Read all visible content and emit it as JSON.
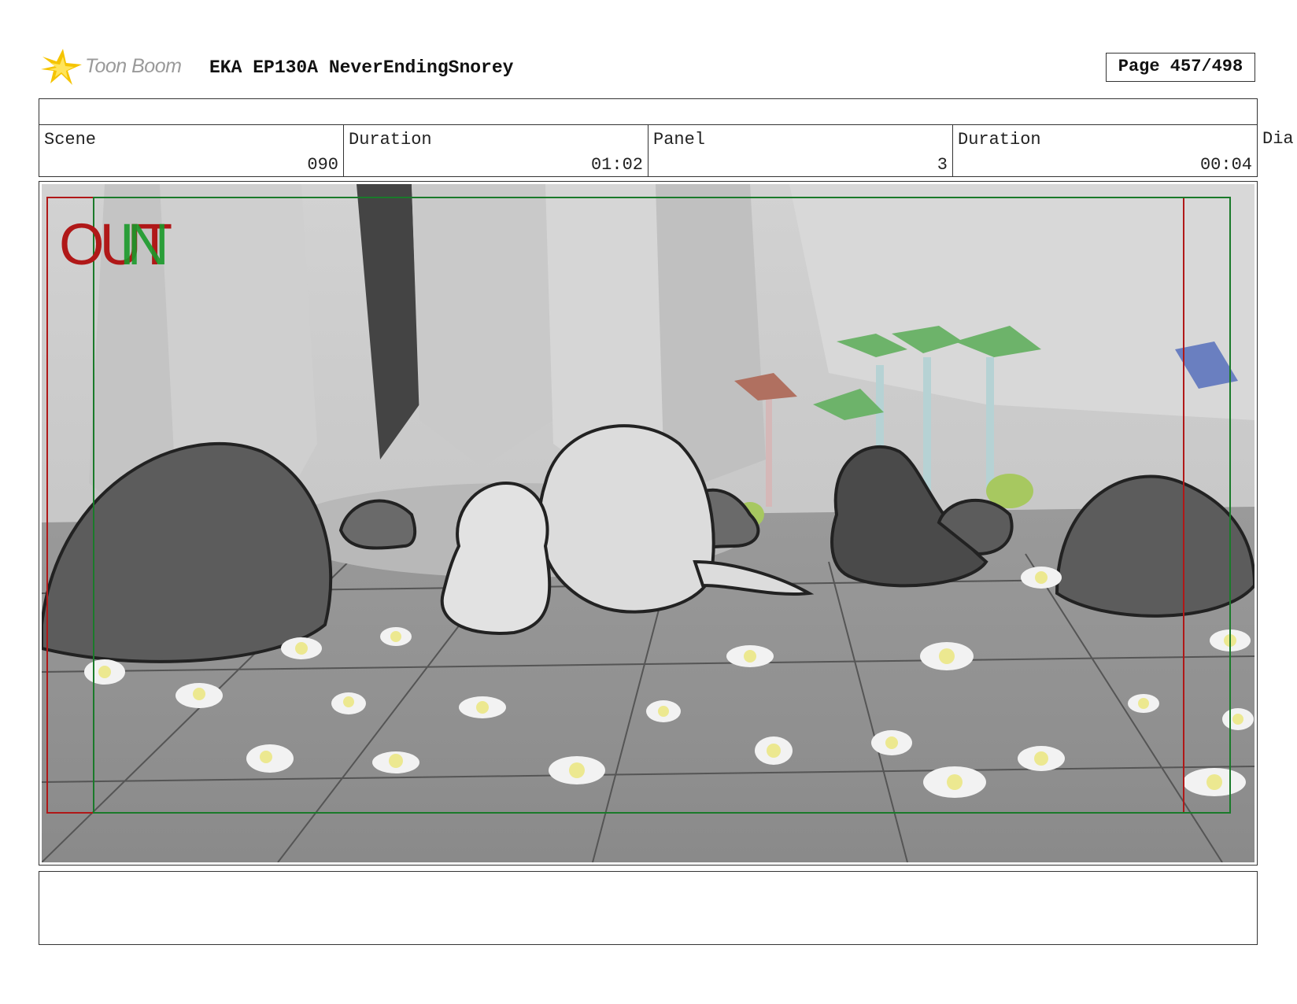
{
  "header": {
    "logo_text": "Toon Boom",
    "title": "EKA EP130A NeverEndingSnorey",
    "page_label": "Page 457/498"
  },
  "info": {
    "scene_label": "Scene",
    "scene_value": "090",
    "duration_label": "Duration",
    "duration_value": "01:02",
    "panel_label": "Panel",
    "panel_value": "3",
    "panel_duration_label": "Duration",
    "panel_duration_value": "00:04",
    "dialog_label_partial": "Dia"
  },
  "panel_overlay": {
    "out_text": "OUT",
    "in_text": "IN"
  },
  "colors": {
    "safe_frame_red": "#b01818",
    "safe_frame_green": "#1a7a2a",
    "logo_yellow": "#f5c400"
  }
}
